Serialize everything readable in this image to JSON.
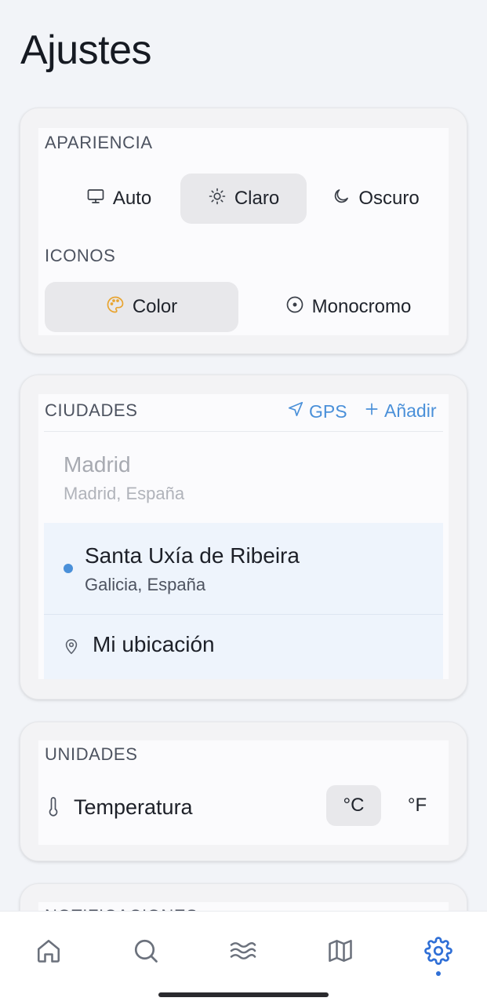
{
  "page": {
    "title": "Ajustes"
  },
  "appearance": {
    "label": "APARIENCIA",
    "theme_options": [
      {
        "label": "Auto",
        "icon": "monitor-icon",
        "selected": false
      },
      {
        "label": "Claro",
        "icon": "sun-icon",
        "selected": true
      },
      {
        "label": "Oscuro",
        "icon": "moon-icon",
        "selected": false
      }
    ],
    "icons_label": "ICONOS",
    "icon_options": [
      {
        "label": "Color",
        "icon": "palette-icon",
        "selected": true
      },
      {
        "label": "Monocromo",
        "icon": "circle-dot-icon",
        "selected": false
      }
    ]
  },
  "cities": {
    "label": "CIUDADES",
    "gps_label": "GPS",
    "add_label": "Añadir",
    "items": [
      {
        "name": "Madrid",
        "region": "Madrid, España",
        "active": false
      },
      {
        "name": "Santa Uxía de Ribeira",
        "region": "Galicia, España",
        "active": true
      }
    ],
    "my_location_label": "Mi ubicación"
  },
  "units": {
    "label": "UNIDADES",
    "temperature_label": "Temperatura",
    "celsius": "°C",
    "fahrenheit": "°F",
    "selected": "°C"
  },
  "notifications": {
    "label": "NOTIFICACIONES"
  },
  "nav": {
    "items": [
      "home-icon",
      "search-icon",
      "waves-icon",
      "map-icon",
      "gear-icon"
    ],
    "active": "gear-icon"
  },
  "colors": {
    "accent": "#4a90d9",
    "nav_active": "#2f6fd6",
    "selected_bg": "#e8e8eb",
    "active_city_bg": "#eef4fc",
    "palette_icon": "#e8a430"
  }
}
